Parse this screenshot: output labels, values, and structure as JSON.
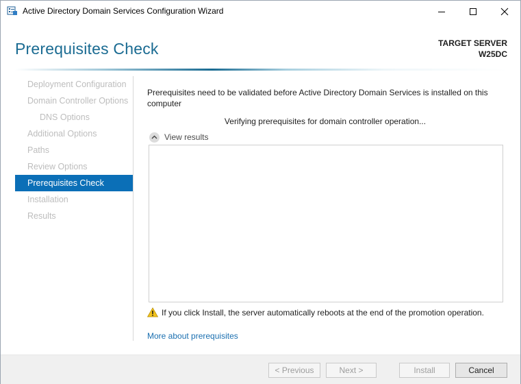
{
  "window": {
    "title": "Active Directory Domain Services Configuration Wizard"
  },
  "header": {
    "page_title": "Prerequisites Check",
    "target_server_label": "TARGET SERVER",
    "target_server_name": "W25DC"
  },
  "nav": {
    "items": [
      {
        "label": "Deployment Configuration",
        "state": "disabled"
      },
      {
        "label": "Domain Controller Options",
        "state": "disabled"
      },
      {
        "label": "DNS Options",
        "state": "disabled",
        "sub": true
      },
      {
        "label": "Additional Options",
        "state": "disabled"
      },
      {
        "label": "Paths",
        "state": "disabled"
      },
      {
        "label": "Review Options",
        "state": "disabled"
      },
      {
        "label": "Prerequisites Check",
        "state": "active"
      },
      {
        "label": "Installation",
        "state": "disabled"
      },
      {
        "label": "Results",
        "state": "disabled"
      }
    ]
  },
  "main": {
    "description": "Prerequisites need to be validated before Active Directory Domain Services is installed on this computer",
    "status": "Verifying prerequisites for domain controller operation...",
    "view_results_label": "View results",
    "warning_text": "If you click Install, the server automatically reboots at the end of the promotion operation.",
    "more_link": "More about prerequisites"
  },
  "footer": {
    "previous_label": "< Previous",
    "next_label": "Next >",
    "install_label": "Install",
    "cancel_label": "Cancel"
  },
  "colors": {
    "accent": "#0b6fb7",
    "title_blue": "#1a6b92",
    "link": "#1a6fb0",
    "warning": "#f2c21b"
  },
  "icons": {
    "app": "ad-ds-wizard-icon",
    "minimize": "minimize-icon",
    "maximize": "maximize-icon",
    "close": "close-icon",
    "collapse": "chevron-up-icon",
    "warning": "warning-icon"
  }
}
